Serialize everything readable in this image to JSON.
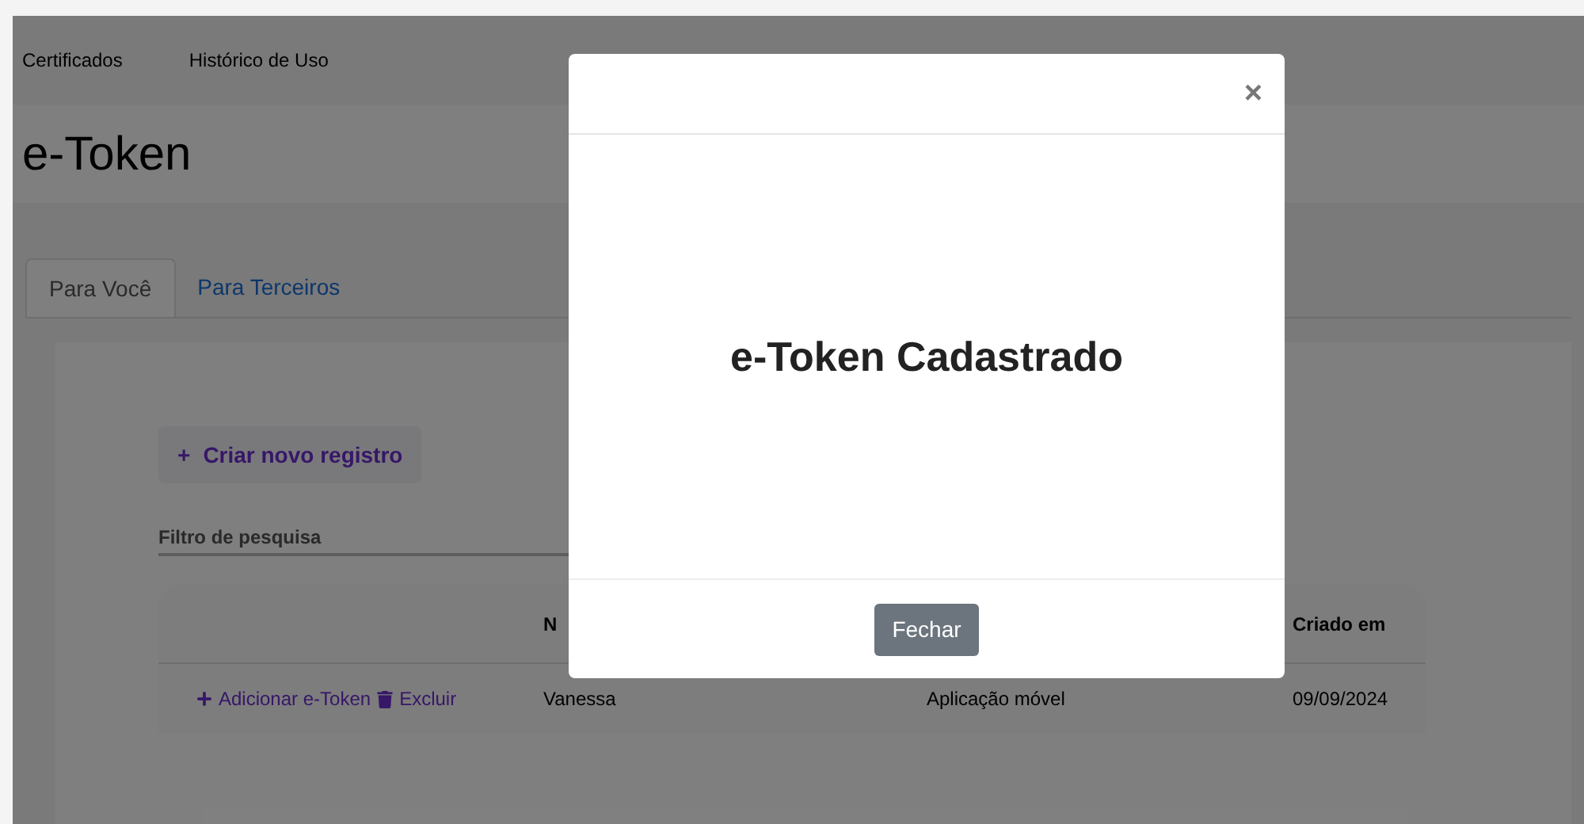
{
  "nav": {
    "items": [
      "Certificados",
      "Histórico de Uso"
    ]
  },
  "page_title": "e-Token",
  "tabs": [
    {
      "label": "Para Você",
      "selected": true
    },
    {
      "label": "Para Terceiros",
      "selected": false
    }
  ],
  "create_button": {
    "icon": "+",
    "label": "Criar novo registro"
  },
  "filter": {
    "placeholder": "Filtro de pesquisa"
  },
  "table": {
    "columns": [
      "N",
      "",
      "Criado em"
    ],
    "rows": [
      {
        "actions": [
          {
            "kind": "add",
            "label": "Adicionar e-Token"
          },
          {
            "kind": "delete",
            "label": "Excluir"
          }
        ],
        "cells": [
          "Vanessa",
          "Aplicação móvel",
          "09/09/2024"
        ]
      }
    ]
  },
  "modal": {
    "close": "×",
    "title": "e-Token Cadastrado",
    "button": "Fechar"
  }
}
